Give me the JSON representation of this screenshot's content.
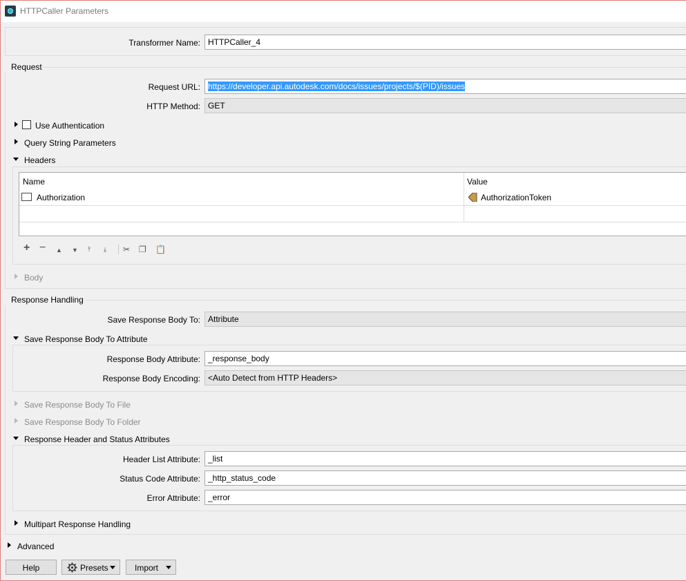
{
  "window": {
    "title": "HTTPCaller Parameters"
  },
  "transformer": {
    "label": "Transformer Name:",
    "value": "HTTPCaller_4"
  },
  "request": {
    "section_label": "Request",
    "url_label": "Request URL:",
    "url_value": "https://developer.api.autodesk.com/docs/issues/projects/$(PID)/issues",
    "method_label": "HTTP Method:",
    "method_value": "GET",
    "use_auth_label": "Use Authentication",
    "query_label": "Query String Parameters",
    "headers_label": "Headers",
    "headers_table": {
      "columns": [
        "Name",
        "Value"
      ],
      "rows": [
        {
          "name": "Authorization",
          "value": "AuthorizationToken"
        }
      ]
    },
    "body_label": "Body"
  },
  "response": {
    "section_label": "Response Handling",
    "save_to_label": "Save Response Body To:",
    "save_to_value": "Attribute",
    "save_attr_section": "Save Response Body To Attribute",
    "body_attr_label": "Response Body Attribute:",
    "body_attr_value": "_response_body",
    "encoding_label": "Response Body Encoding:",
    "encoding_value": "<Auto Detect from HTTP Headers>",
    "save_file_label": "Save Response Body To File",
    "save_folder_label": "Save Response Body To Folder",
    "header_status_section": "Response Header and Status Attributes",
    "header_list_label": "Header List Attribute:",
    "header_list_value": "_list",
    "status_code_label": "Status Code Attribute:",
    "status_code_value": "_http_status_code",
    "error_label": "Error Attribute:",
    "error_value": "_error",
    "multipart_label": "Multipart Response Handling"
  },
  "advanced_label": "Advanced",
  "buttons": {
    "help": "Help",
    "presets": "Presets",
    "import": "Import"
  },
  "icons": {
    "app": "httpcaller-app-icon",
    "value_type": "attribute-value-icon",
    "presets": "gear-icon"
  }
}
